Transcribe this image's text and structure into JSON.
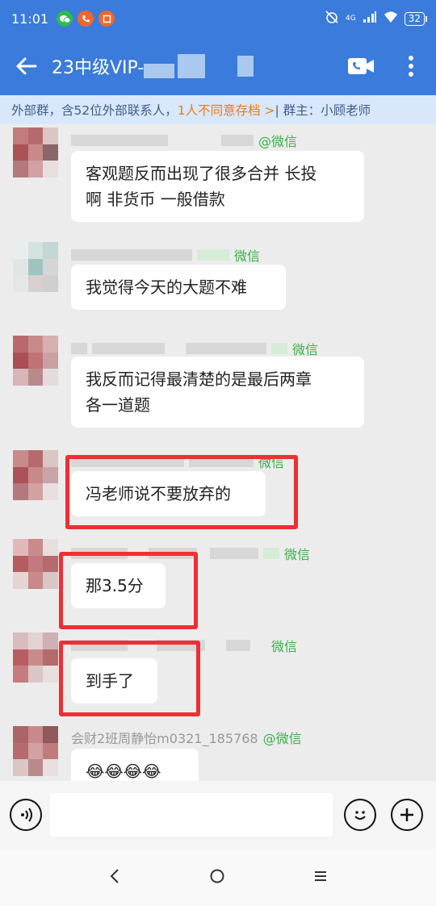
{
  "status": {
    "time": "11:01",
    "battery": "32",
    "network": "4G"
  },
  "header": {
    "title": "23中级VIP-"
  },
  "infobar": {
    "prefix": "外部群，含52位外部联系人，",
    "warn": "1人不同意存档 >",
    "owner": " | 群主：小顾老师"
  },
  "messages": [
    {
      "source": "@微信",
      "text_lines": [
        "客观题反而出现了很多合并 长投",
        "啊 非货币 一般借款"
      ]
    },
    {
      "source": "微信",
      "text_lines": [
        "我觉得今天的大题不难"
      ]
    },
    {
      "source": "微信",
      "text_lines": [
        "我反而记得最清楚的是最后两章",
        "各一道题"
      ]
    },
    {
      "source": "微信",
      "text_lines": [
        "冯老师说不要放弃的"
      ]
    },
    {
      "source": "微信",
      "text_lines": [
        "那3.5分"
      ]
    },
    {
      "source": "微信",
      "text_lines": [
        "到手了"
      ]
    },
    {
      "sender_name": "会财2班周静怡m0321_185768",
      "source": "@微信",
      "text_lines": [
        "😂😂😂😂"
      ]
    }
  ],
  "colors": {
    "header_bg": "#3a7bdc",
    "infobar_bg": "#d8e7fb",
    "warn": "#ee7b15",
    "wechat_green": "#3bb04a",
    "highlight_red": "#ef2f33"
  }
}
